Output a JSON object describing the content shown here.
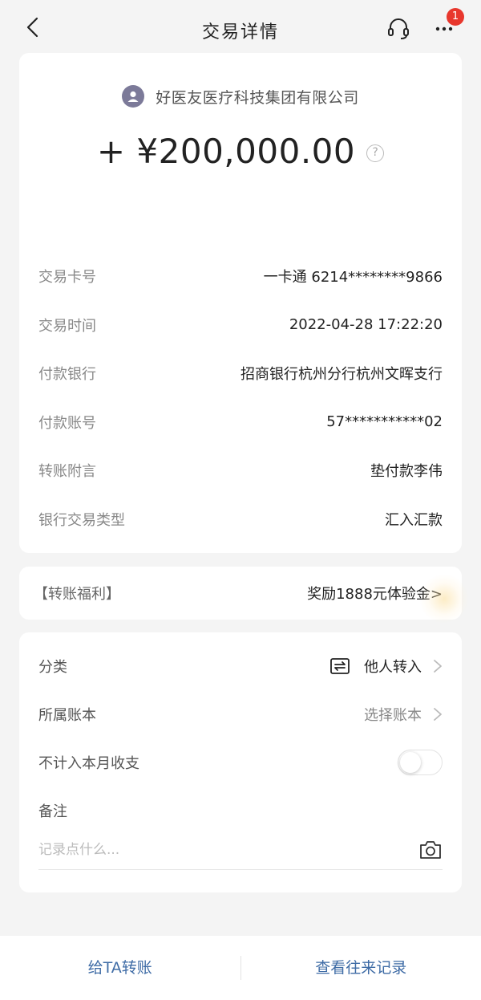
{
  "header": {
    "title": "交易详情",
    "back_icon": "chevron-left-icon",
    "service_icon": "headset-icon",
    "more_icon": "more-dots-icon",
    "notification_count": "1"
  },
  "transaction": {
    "payer_name": "好医友医疗科技集团有限公司",
    "amount": "+ ¥200,000.00",
    "help_symbol": "?",
    "details": [
      {
        "label": "交易卡号",
        "value": "一卡通 6214********9866"
      },
      {
        "label": "交易时间",
        "value": "2022-04-28 17:22:20"
      },
      {
        "label": "付款银行",
        "value": "招商银行杭州分行杭州文晖支行"
      },
      {
        "label": "付款账号",
        "value": "57***********02"
      },
      {
        "label": "转账附言",
        "value": "垫付款李伟"
      },
      {
        "label": "银行交易类型",
        "value": "汇入汇款"
      }
    ]
  },
  "benefit": {
    "label": "【转账福利】",
    "value": "奖励1888元体验金>"
  },
  "settings": {
    "category_label": "分类",
    "category_value": "他人转入",
    "ledger_label": "所属账本",
    "ledger_value": "选择账本",
    "exclude_label": "不计入本月收支",
    "exclude_on": false,
    "note_label": "备注",
    "note_value": "",
    "note_placeholder": "记录点什么..."
  },
  "bottom": {
    "transfer_label": "给TA转账",
    "history_label": "查看往来记录"
  },
  "colors": {
    "accent": "#3f6ca6",
    "badge": "#e8372d",
    "background": "#f4f4f4"
  }
}
